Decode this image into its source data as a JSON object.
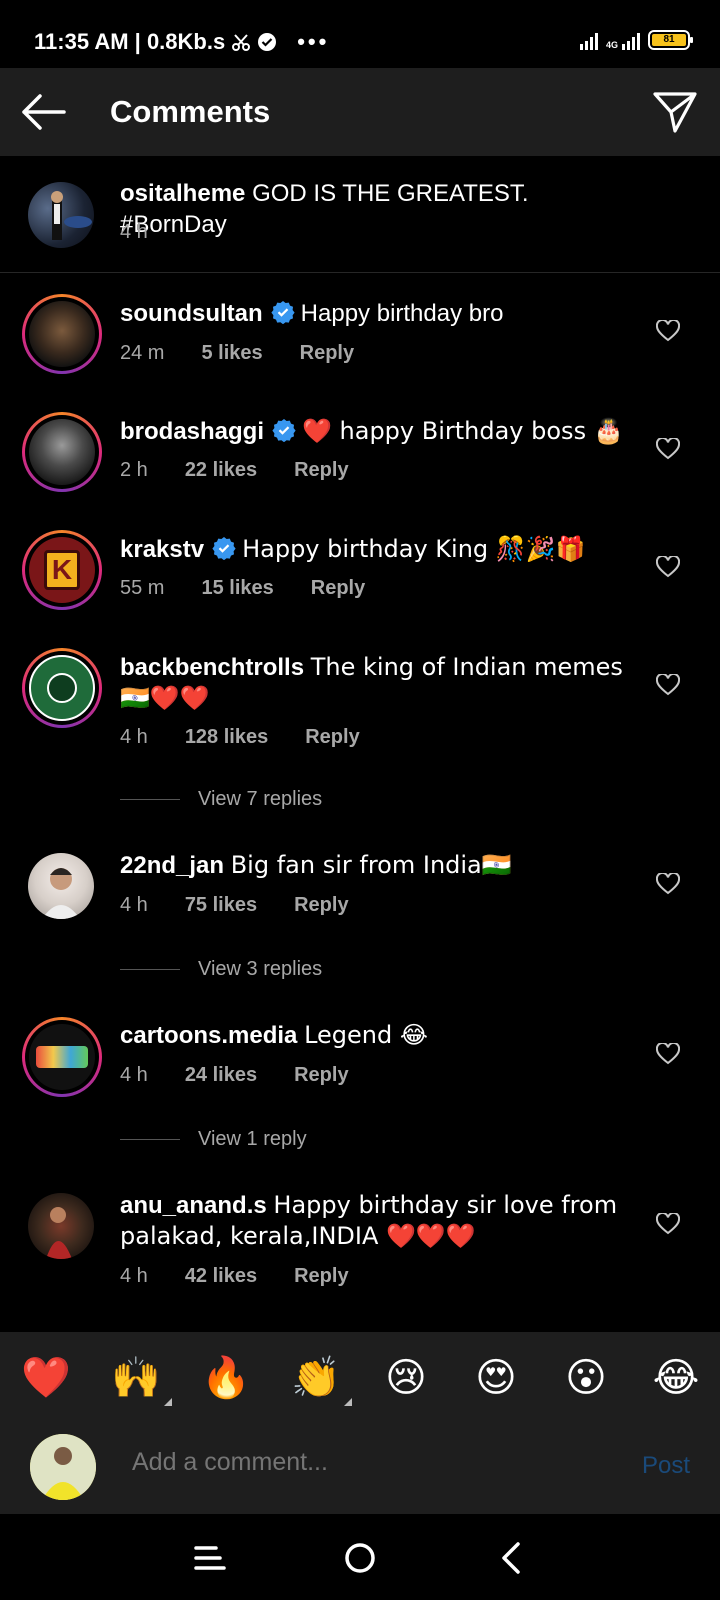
{
  "status": {
    "time_speed": "11:35 AM | 0.8Kb.s",
    "network": "4G",
    "battery": "81"
  },
  "appbar": {
    "title": "Comments"
  },
  "caption": {
    "username": "ositalheme",
    "text": "GOD IS THE GREATEST.  #BornDay",
    "time": "4 h"
  },
  "comments": [
    {
      "username": "soundsultan",
      "verified": true,
      "text": "Happy birthday bro",
      "time": "24 m",
      "likes": "5 likes",
      "reply": "Reply"
    },
    {
      "username": "brodashaggi",
      "verified": true,
      "text": "❤️ happy Birthday boss 🎂",
      "time": "2 h",
      "likes": "22 likes",
      "reply": "Reply"
    },
    {
      "username": "krakstv",
      "verified": true,
      "text": "Happy birthday King 🎊🎉🎁",
      "time": "55 m",
      "likes": "15 likes",
      "reply": "Reply"
    },
    {
      "username": "backbenchtrolls",
      "verified": false,
      "text": "The king of Indian memes 🇮🇳❤️❤️",
      "time": "4 h",
      "likes": "128 likes",
      "reply": "Reply",
      "view_replies": "View 7 replies"
    },
    {
      "username": "22nd_jan",
      "verified": false,
      "text": "Big fan sir from India🇮🇳",
      "time": "4 h",
      "likes": "75 likes",
      "reply": "Reply",
      "view_replies": "View 3 replies"
    },
    {
      "username": "cartoons.media",
      "verified": false,
      "text": "Legend 😂",
      "time": "4 h",
      "likes": "24 likes",
      "reply": "Reply",
      "view_replies": "View 1 reply"
    },
    {
      "username": "anu_anand.s",
      "verified": false,
      "text": "Happy birthday sir love from palakad, kerala,INDIA ❤️❤️❤️",
      "time": "4 h",
      "likes": "42 likes",
      "reply": "Reply"
    }
  ],
  "reactions": [
    "❤️",
    "🙌",
    "🔥",
    "👏",
    "😢",
    "😍",
    "😮",
    "😂"
  ],
  "composer": {
    "placeholder": "Add a comment...",
    "post_label": "Post"
  },
  "colors": {
    "background": "#000000",
    "bar": "#1e1e1e",
    "verified": "#3897f0",
    "muted": "#a8a8a8",
    "post_disabled": "#1a4a7a",
    "heart": "#ed4956"
  }
}
